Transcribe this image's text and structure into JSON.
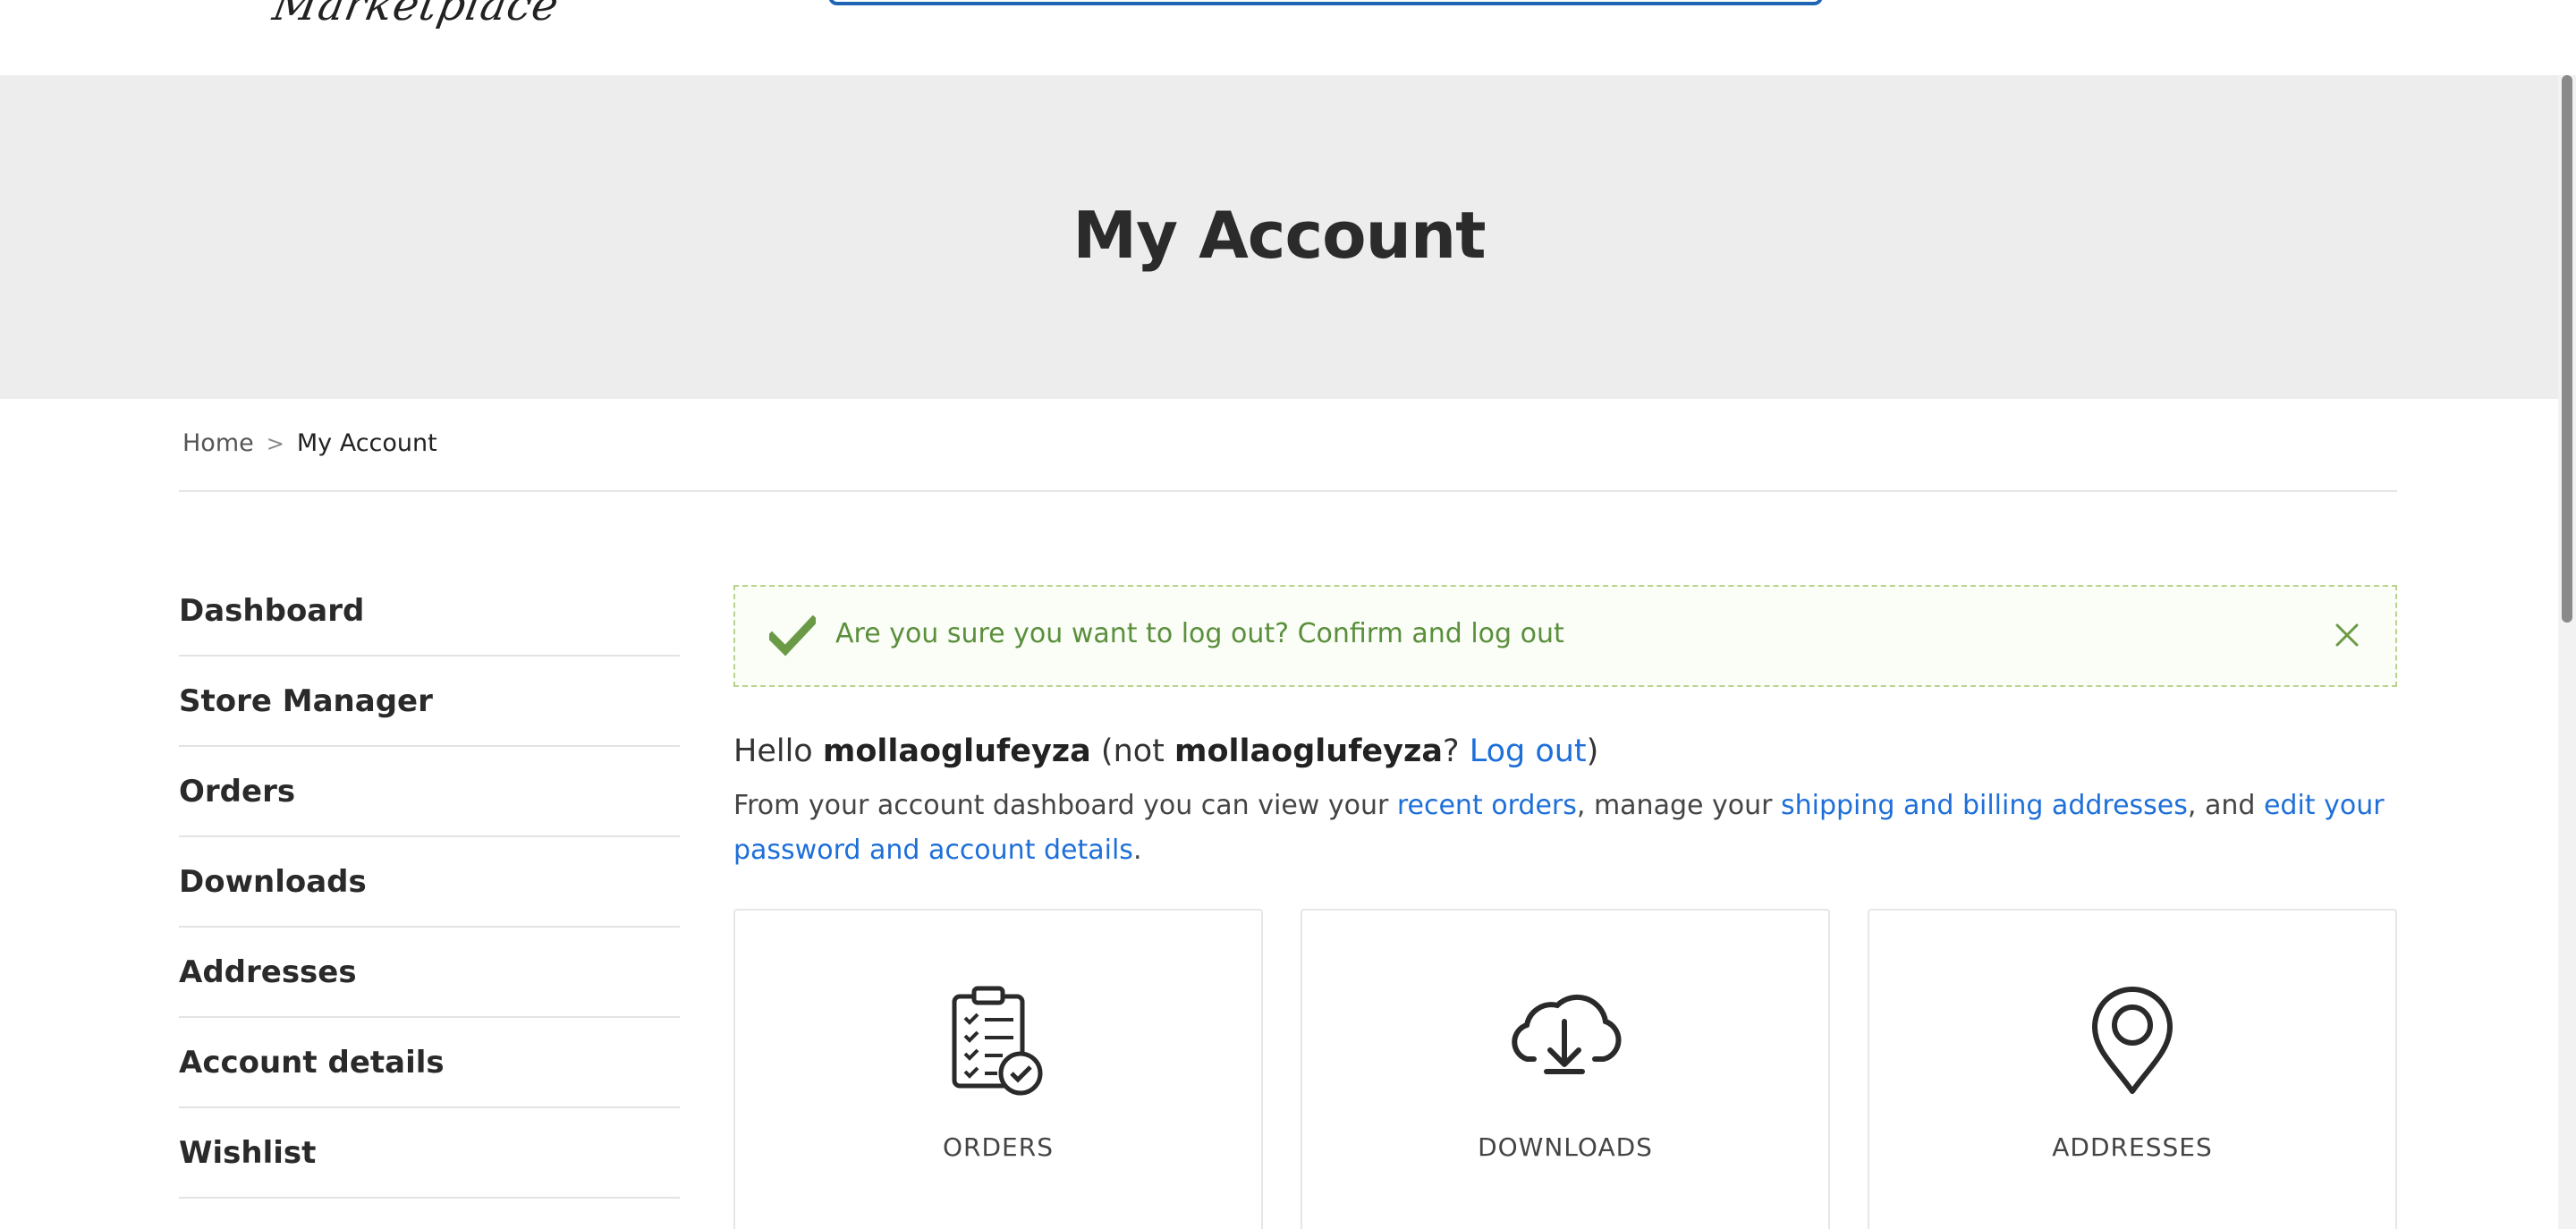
{
  "header": {
    "logo_text": "Marketplace",
    "search_placeholder": ""
  },
  "hero": {
    "title": "My Account"
  },
  "breadcrumb": {
    "home": "Home",
    "separator": ">",
    "current": "My Account"
  },
  "sidebar": {
    "items": [
      {
        "label": "Dashboard"
      },
      {
        "label": "Store Manager"
      },
      {
        "label": "Orders"
      },
      {
        "label": "Downloads"
      },
      {
        "label": "Addresses"
      },
      {
        "label": "Account details"
      },
      {
        "label": "Wishlist"
      }
    ]
  },
  "notice": {
    "text": "Are you sure you want to log out? Confirm and log out",
    "color": "#5a8f3c"
  },
  "greeting": {
    "hello": "Hello",
    "username": "mollaoglufeyza",
    "not_prefix": "(not",
    "username2": "mollaoglufeyza",
    "question": "?",
    "logout_link": "Log out",
    "close_paren": ")"
  },
  "intro": {
    "part1": "From your account dashboard you can view your ",
    "link_orders": "recent orders",
    "part2": ", manage your ",
    "link_addresses": "shipping and billing addresses",
    "part3": ", and ",
    "link_account": "edit your password and account details",
    "part4": "."
  },
  "cards": [
    {
      "label": "ORDERS",
      "icon": "clipboard-check-icon"
    },
    {
      "label": "DOWNLOADS",
      "icon": "cloud-download-icon"
    },
    {
      "label": "ADDRESSES",
      "icon": "map-pin-icon"
    }
  ],
  "colors": {
    "link": "#1e6fd9",
    "hero_bg": "#ededed",
    "search_border": "#1e64b4"
  }
}
